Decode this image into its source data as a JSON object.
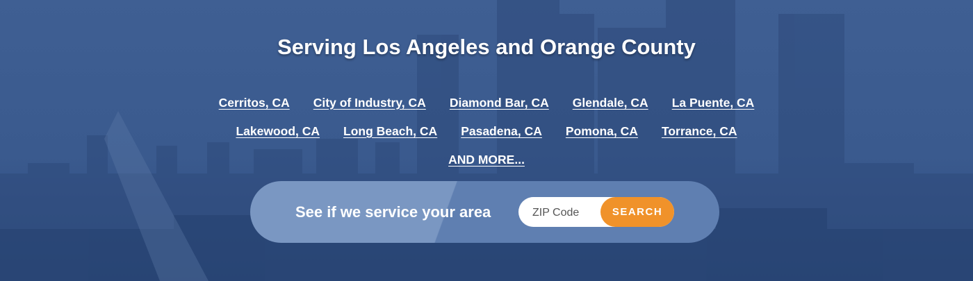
{
  "hero": {
    "title": "Serving Los Angeles and Orange County",
    "cities_row1": [
      "Cerritos, CA",
      "City of Industry, CA",
      "Diamond Bar, CA",
      "Glendale, CA",
      "La Puente, CA"
    ],
    "cities_row2": [
      "Lakewood, CA",
      "Long Beach, CA",
      "Pasadena, CA",
      "Pomona, CA",
      "Torrance, CA"
    ],
    "more_link": "AND MORE..."
  },
  "search": {
    "label": "See if we service your area",
    "zip_placeholder": "ZIP Code",
    "zip_value": "",
    "button_label": "SEARCH"
  },
  "colors": {
    "background": "#3a5a8e",
    "accent_button": "#f0922a",
    "search_bar_light": "#7a97c2",
    "search_bar_dark": "#5f7fb1"
  }
}
